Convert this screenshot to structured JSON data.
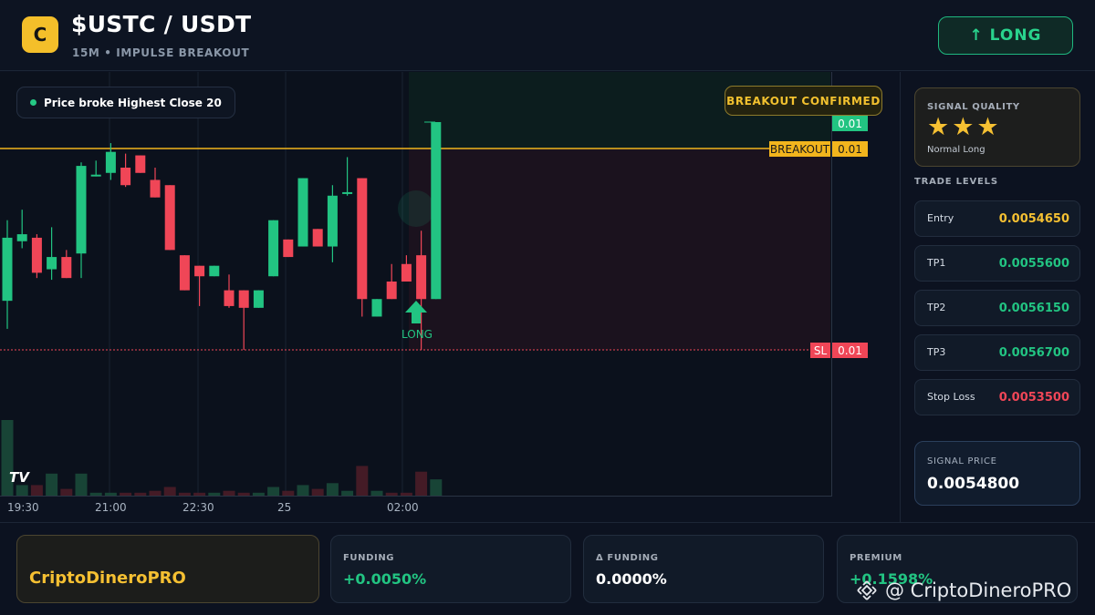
{
  "header": {
    "logo_letter": "C",
    "pair": "$USTC / USDT",
    "subtitle": "15M • IMPULSE BREAKOUT",
    "signal_button": "↑ LONG"
  },
  "chart": {
    "info_pill": "Price broke Highest Close 20",
    "confirmed_badge": "BREAKOUT CONFIRMED",
    "price_tag_top": "0.01",
    "breakout_label": "BREAKOUT",
    "breakout_value": "0.01",
    "sl_label": "SL",
    "sl_value": "0.01",
    "long_marker": "LONG",
    "watermark_logo": "TV",
    "x_labels": [
      "19:30",
      "21:00",
      "22:30",
      "25",
      "02:00"
    ],
    "colors": {
      "up": "#22c482",
      "down": "#f04657",
      "breakout": "#f2b51d",
      "sl": "#f04657"
    }
  },
  "chart_data": {
    "type": "candlestick",
    "x_tick_labels": [
      "19:30",
      "21:00",
      "22:30",
      "25",
      "02:00"
    ],
    "levels": {
      "breakout": "0.01",
      "stop_loss": "0.01"
    },
    "candles": [
      {
        "dir": "up",
        "o": 28,
        "c": 64,
        "h": 74,
        "l": 12
      },
      {
        "dir": "up",
        "o": 62,
        "c": 66,
        "h": 80,
        "l": 58
      },
      {
        "dir": "down",
        "o": 64,
        "c": 44,
        "h": 66,
        "l": 41
      },
      {
        "dir": "up",
        "o": 46,
        "c": 53,
        "h": 70,
        "l": 40
      },
      {
        "dir": "down",
        "o": 53,
        "c": 41,
        "h": 57,
        "l": 41
      },
      {
        "dir": "up",
        "o": 55,
        "c": 105,
        "h": 107,
        "l": 41
      },
      {
        "dir": "up",
        "o": 100,
        "c": 100,
        "h": 108,
        "l": 99
      },
      {
        "dir": "up",
        "o": 101,
        "c": 113,
        "h": 118,
        "l": 97
      },
      {
        "dir": "down",
        "o": 104,
        "c": 94,
        "h": 112,
        "l": 93
      },
      {
        "dir": "down",
        "o": 111,
        "c": 101,
        "h": 111,
        "l": 101
      },
      {
        "dir": "down",
        "o": 97,
        "c": 87,
        "h": 104,
        "l": 87
      },
      {
        "dir": "down",
        "o": 94,
        "c": 57,
        "h": 94,
        "l": 57
      },
      {
        "dir": "down",
        "o": 54,
        "c": 34,
        "h": 54,
        "l": 34
      },
      {
        "dir": "down",
        "o": 48,
        "c": 42,
        "h": 48,
        "l": 25
      },
      {
        "dir": "up",
        "o": 42,
        "c": 48,
        "h": 48,
        "l": 42
      },
      {
        "dir": "down",
        "o": 25,
        "c": 34,
        "h": 43,
        "l": 24
      },
      {
        "dir": "down",
        "o": 34,
        "c": 24,
        "h": 34,
        "l": 0
      },
      {
        "dir": "up",
        "o": 24,
        "c": 34,
        "h": 34,
        "l": 24
      },
      {
        "dir": "up",
        "o": 42,
        "c": 74,
        "h": 74,
        "l": 42
      },
      {
        "dir": "down",
        "o": 63,
        "c": 53,
        "h": 63,
        "l": 53
      },
      {
        "dir": "up",
        "o": 59,
        "c": 98,
        "h": 98,
        "l": 59
      },
      {
        "dir": "down",
        "o": 69,
        "c": 59,
        "h": 69,
        "l": 59
      },
      {
        "dir": "up",
        "o": 59,
        "c": 88,
        "h": 94,
        "l": 50
      },
      {
        "dir": "up",
        "o": 89,
        "c": 90,
        "h": 110,
        "l": 88
      },
      {
        "dir": "down",
        "o": 98,
        "c": 29,
        "h": 98,
        "l": 19
      },
      {
        "dir": "up",
        "o": 29,
        "c": 19,
        "h": 29,
        "l": 19
      },
      {
        "dir": "down",
        "o": 39,
        "c": 29,
        "h": 49,
        "l": 29
      },
      {
        "dir": "down",
        "o": 49,
        "c": 39,
        "h": 54,
        "l": 39
      },
      {
        "dir": "down",
        "o": 54,
        "c": 29,
        "h": 68,
        "l": 0
      },
      {
        "dir": "up",
        "o": 29,
        "c": 130,
        "h": 130,
        "l": 29
      }
    ],
    "volume": [
      40,
      6,
      6,
      12,
      4,
      12,
      2,
      2,
      2,
      2,
      3,
      5,
      2,
      2,
      2,
      3,
      2,
      2,
      5,
      3,
      6,
      4,
      7,
      3,
      16,
      3,
      2,
      2,
      13,
      9
    ]
  },
  "sidebar": {
    "signal_quality_title": "SIGNAL QUALITY",
    "stars": "★★★",
    "quality_text": "Normal Long",
    "trade_levels_title": "TRADE LEVELS",
    "levels": [
      {
        "label": "Entry",
        "value": "0.0054650",
        "color": "#f5c032"
      },
      {
        "label": "TP1",
        "value": "0.0055600",
        "color": "#22c482"
      },
      {
        "label": "TP2",
        "value": "0.0056150",
        "color": "#22c482"
      },
      {
        "label": "TP3",
        "value": "0.0056700",
        "color": "#22c482"
      },
      {
        "label": "Stop Loss",
        "value": "0.0053500",
        "color": "#f04657"
      }
    ],
    "signal_price_label": "SIGNAL PRICE",
    "signal_price": "0.0054800"
  },
  "footer": {
    "brand": "CriptoDineroPRO",
    "stats": [
      {
        "label": "FUNDING",
        "value": "+0.0050%",
        "color": "#22c482"
      },
      {
        "label": "Δ FUNDING",
        "value": "0.0000%",
        "color": "#ffffff"
      },
      {
        "label": "PREMIUM",
        "value": "+0.1598%",
        "color": "#22c482"
      }
    ],
    "watermark": "@ CriptoDineroPRO"
  }
}
